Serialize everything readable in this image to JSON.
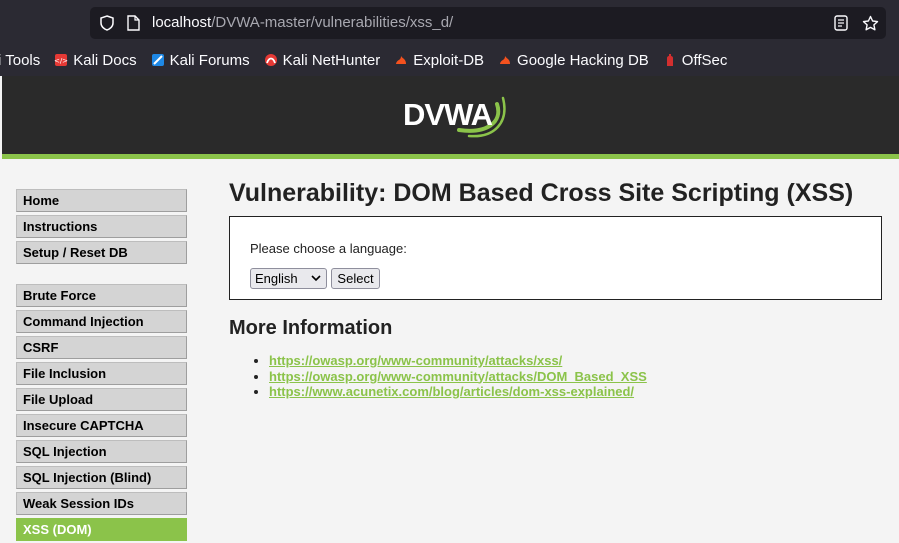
{
  "browser": {
    "url_host": "localhost",
    "url_path": "/DVWA-master/vulnerabilities/xss_d/",
    "bookmarks": [
      {
        "label": "i Tools",
        "icon": "kali-tools-icon"
      },
      {
        "label": "Kali Docs",
        "icon": "kali-docs-icon"
      },
      {
        "label": "Kali Forums",
        "icon": "kali-forums-icon"
      },
      {
        "label": "Kali NetHunter",
        "icon": "kali-nethunter-icon"
      },
      {
        "label": "Exploit-DB",
        "icon": "exploit-db-icon"
      },
      {
        "label": "Google Hacking DB",
        "icon": "ghdb-icon"
      },
      {
        "label": "OffSec",
        "icon": "offsec-icon"
      }
    ]
  },
  "logo": {
    "text": "DVWA"
  },
  "menu": {
    "group1": [
      {
        "label": "Home"
      },
      {
        "label": "Instructions"
      },
      {
        "label": "Setup / Reset DB"
      }
    ],
    "group2": [
      {
        "label": "Brute Force"
      },
      {
        "label": "Command Injection"
      },
      {
        "label": "CSRF"
      },
      {
        "label": "File Inclusion"
      },
      {
        "label": "File Upload"
      },
      {
        "label": "Insecure CAPTCHA"
      },
      {
        "label": "SQL Injection"
      },
      {
        "label": "SQL Injection (Blind)"
      },
      {
        "label": "Weak Session IDs"
      },
      {
        "label": "XSS (DOM)"
      }
    ],
    "active": "XSS (DOM)"
  },
  "main": {
    "title": "Vulnerability: DOM Based Cross Site Scripting (XSS)",
    "prompt": "Please choose a language:",
    "language_selected": "English",
    "select_button": "Select",
    "more_info_heading": "More Information",
    "links": [
      "https://owasp.org/www-community/attacks/xss/",
      "https://owasp.org/www-community/attacks/DOM_Based_XSS",
      "https://www.acunetix.com/blog/articles/dom-xss-explained/"
    ]
  },
  "colors": {
    "accent": "#8bc34a",
    "header_bg": "#2a2a2a",
    "chrome_bg": "#2b2a33"
  }
}
